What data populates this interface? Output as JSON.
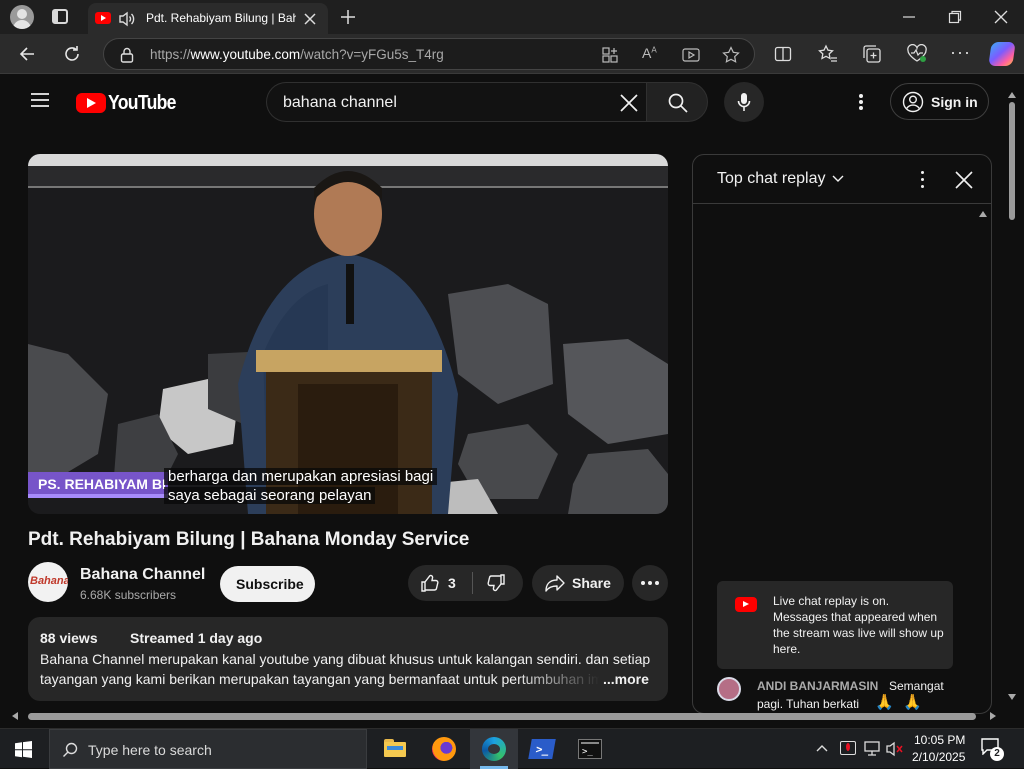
{
  "browser": {
    "tab_title": "Pdt. Rehabiyam Bilung | Bahana",
    "url_prefix": "https://",
    "url_domain": "www.youtube.com",
    "url_path": "/watch?v=yFGu5s_T4rg"
  },
  "youtube": {
    "logo_text": "YouTube",
    "search_value": "bahana channel",
    "sign_in_label": "Sign in",
    "video": {
      "title": "Pdt. Rehabiyam Bilung | Bahana Monday Service",
      "lower_third": "PS. REHABIYAM BI",
      "caption_line1": "berharga dan merupakan apresiasi bagi",
      "caption_line2": "saya sebagai seorang pelayan"
    },
    "channel": {
      "name": "Bahana Channel",
      "subscribers": "6.68K subscribers",
      "subscribe_label": "Subscribe",
      "avatar_text": "Bahana"
    },
    "actions": {
      "like_count": "3",
      "share_label": "Share"
    },
    "description": {
      "views": "88 views",
      "streamed": "Streamed 1 day ago",
      "line1": "Bahana Channel merupakan kanal youtube yang dibuat khusus untuk kalangan sendiri. dan setiap",
      "line2": "tayangan yang kami berikan merupakan tayangan yang bermanfaat untuk pertumbuhan im",
      "more_label": "...more"
    },
    "chat": {
      "header": "Top chat replay",
      "notice": "Live chat replay is on. Messages that appeared when the stream was live will show up here.",
      "message_author": "ANDI BANJARMASIN",
      "message_text_1": "Semangat",
      "message_text_2": "pagi. Tuhan berkati"
    }
  },
  "taskbar": {
    "search_placeholder": "Type here to search",
    "time": "10:05 PM",
    "date": "2/10/2025",
    "notification_count": "2"
  },
  "colors": {
    "youtube_red": "#ff0000",
    "page_bg": "#0f0f0f",
    "chrome_bg": "#2b2b2b"
  }
}
